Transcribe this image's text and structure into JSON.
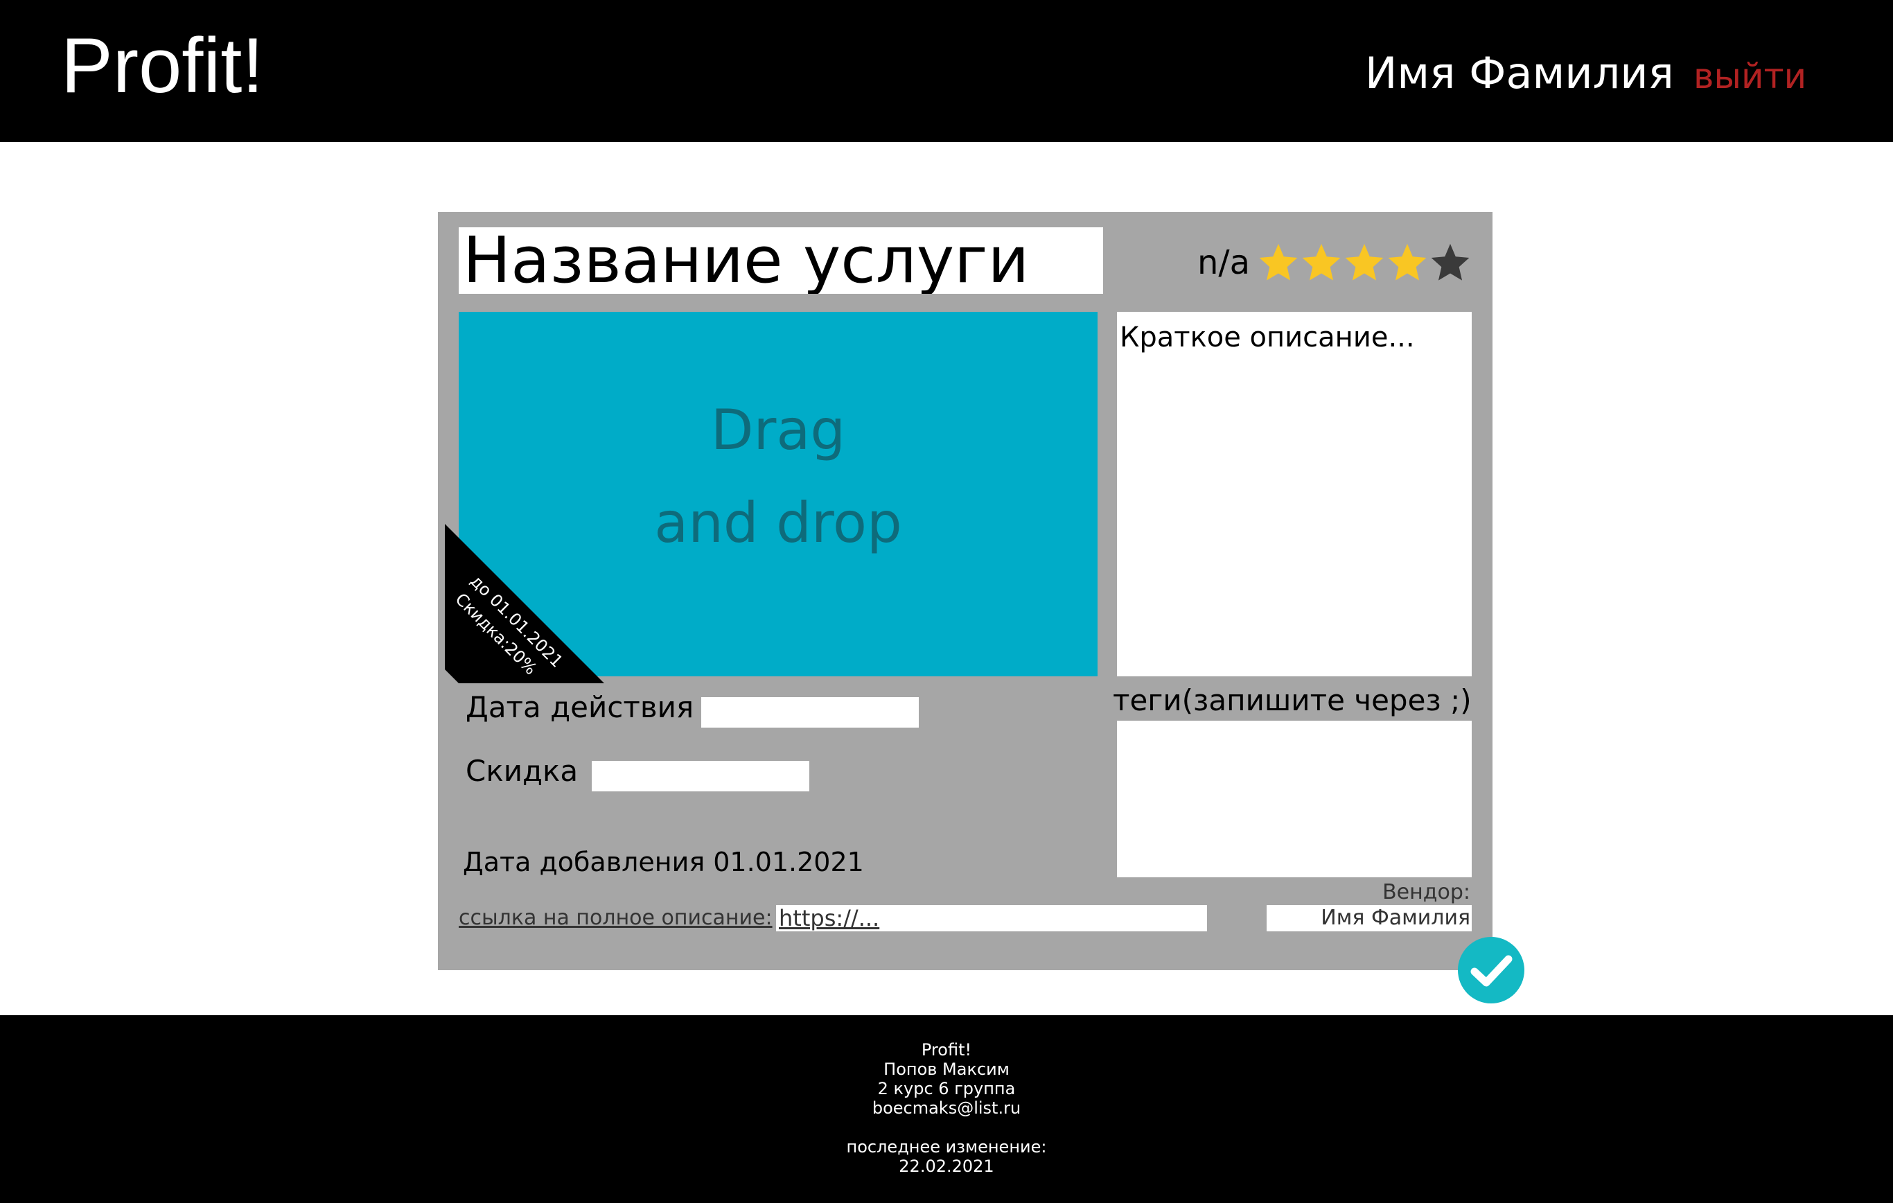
{
  "header": {
    "logo": "Profit!",
    "user_name": "Имя Фамилия",
    "logout_label": "выйти"
  },
  "card": {
    "title": "Название услуги",
    "rating": {
      "value_text": "n/a",
      "stars": [
        {
          "icon": "star-icon",
          "filled": true
        },
        {
          "icon": "star-icon",
          "filled": true
        },
        {
          "icon": "star-icon",
          "filled": true
        },
        {
          "icon": "star-icon",
          "filled": true
        },
        {
          "icon": "star-icon",
          "filled": false
        }
      ],
      "filled_color": "#f9c623",
      "empty_color": "#3a3a3a"
    },
    "image_drop": {
      "line1": "Drag",
      "line2": "and drop",
      "background_color": "#00acc8"
    },
    "ribbon": {
      "date_text": "до 01.01.2021",
      "discount_text": "Скидка:20%"
    },
    "short_description_placeholder": "Краткое описание...",
    "validity_label": "Дата действия",
    "validity_value": "",
    "discount_label": "Скидка",
    "discount_value": "",
    "added_date_text": "Дата добавления 01.01.2021",
    "tags_label": "теги(запишите через ;)",
    "tags_value": "",
    "vendor_label": "Вендор:",
    "vendor_value": "Имя Фамилия",
    "link_label": "ссылка на полное описание:",
    "link_value": "https://...",
    "save_icon": "check-circle-icon",
    "save_color": "#14b9c4"
  },
  "footer": {
    "brand": "Profit!",
    "author": "Попов Максим",
    "group": "2 курс 6 группа",
    "email": "boecmaks@list.ru",
    "last_modified_label": "последнее изменение:",
    "last_modified_date": "22.02.2021"
  }
}
